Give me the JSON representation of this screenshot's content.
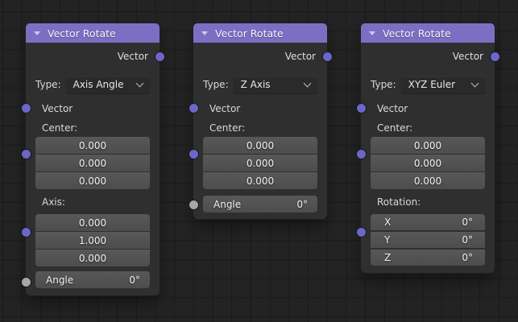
{
  "colors": {
    "header": "#7b6fc4",
    "socket_vector": "#6b66c8",
    "socket_float": "#a6a6a6"
  },
  "nodes": [
    {
      "title": "Vector Rotate",
      "output_label": "Vector",
      "type_label": "Type:",
      "type_value": "Axis Angle",
      "input_vector_label": "Vector",
      "center_label": "Center:",
      "center_values": [
        "0.000",
        "0.000",
        "0.000"
      ],
      "axis_label": "Axis:",
      "axis_values": [
        "0.000",
        "1.000",
        "0.000"
      ],
      "angle_label": "Angle",
      "angle_value": "0°"
    },
    {
      "title": "Vector Rotate",
      "output_label": "Vector",
      "type_label": "Type:",
      "type_value": "Z Axis",
      "input_vector_label": "Vector",
      "center_label": "Center:",
      "center_values": [
        "0.000",
        "0.000",
        "0.000"
      ],
      "angle_label": "Angle",
      "angle_value": "0°"
    },
    {
      "title": "Vector Rotate",
      "output_label": "Vector",
      "type_label": "Type:",
      "type_value": "XYZ Euler",
      "input_vector_label": "Vector",
      "center_label": "Center:",
      "center_values": [
        "0.000",
        "0.000",
        "0.000"
      ],
      "rotation_label": "Rotation:",
      "rotation_rows": [
        {
          "label": "X",
          "value": "0°"
        },
        {
          "label": "Y",
          "value": "0°"
        },
        {
          "label": "Z",
          "value": "0°"
        }
      ]
    }
  ]
}
